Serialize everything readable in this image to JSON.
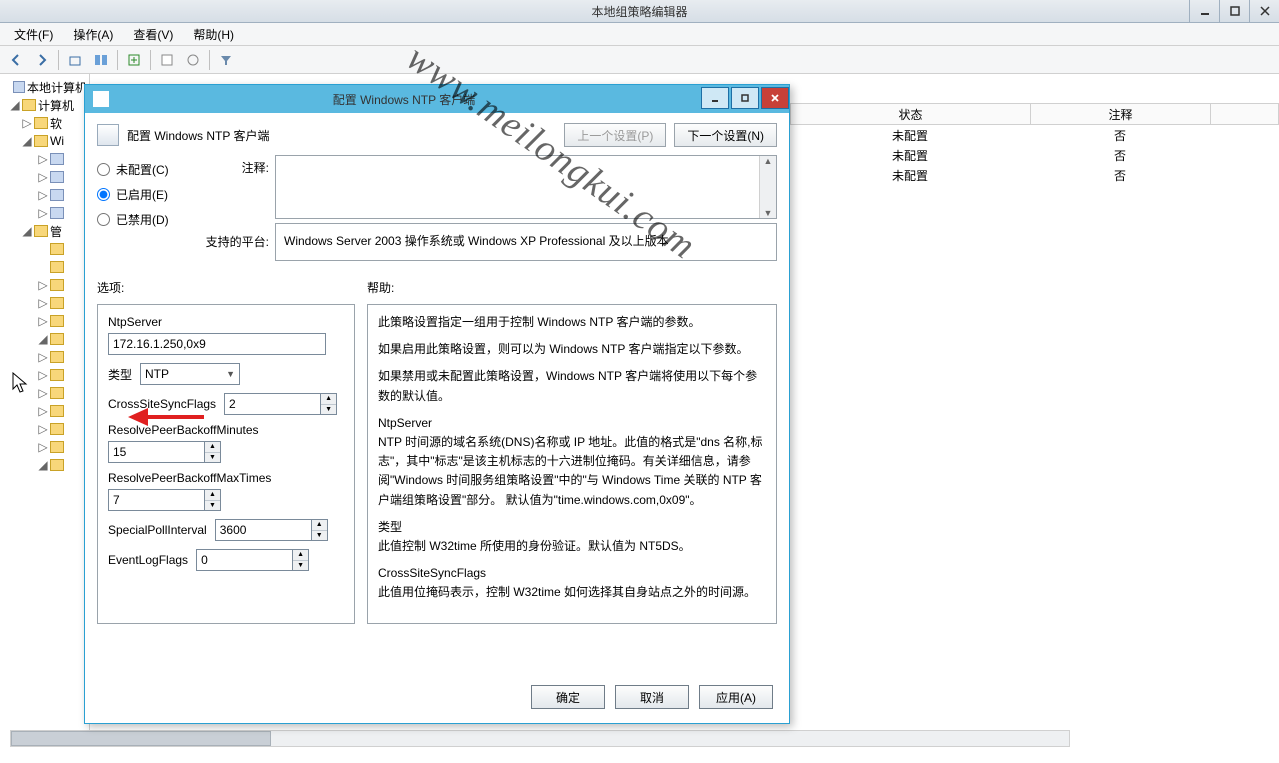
{
  "main": {
    "title": "本地组策略编辑器",
    "menus": {
      "file": "文件(F)",
      "action": "操作(A)",
      "view": "查看(V)",
      "help": "帮助(H)"
    }
  },
  "tree": {
    "root": "本地计算机",
    "n1": "计算机",
    "n2": "软",
    "n3": "Wi",
    "n_admin": "管"
  },
  "list": {
    "hdr_status": "状态",
    "hdr_comment": "注释",
    "rows": [
      {
        "status": "未配置",
        "comment": "否"
      },
      {
        "status": "未配置",
        "comment": "否"
      },
      {
        "status": "未配置",
        "comment": "否"
      }
    ]
  },
  "dialog": {
    "title": "配置 Windows NTP 客户端",
    "header_title": "配置 Windows NTP 客户端",
    "prev": "上一个设置(P)",
    "next": "下一个设置(N)",
    "radio_notconf": "未配置(C)",
    "radio_enabled": "已启用(E)",
    "radio_disabled": "已禁用(D)",
    "comment_label": "注释:",
    "platform_label": "支持的平台:",
    "platform_text": "Windows Server 2003 操作系统或 Windows XP Professional 及以上版本",
    "options_label": "选项:",
    "help_label": "帮助:",
    "opts": {
      "ntpserver_label": "NtpServer",
      "ntpserver_value": "172.16.1.250,0x9",
      "type_label": "类型",
      "type_value": "NTP",
      "crosssite_label": "CrossSiteSyncFlags",
      "crosssite_value": "2",
      "resolvemin_label": "ResolvePeerBackoffMinutes",
      "resolvemin_value": "15",
      "resolvemax_label": "ResolvePeerBackoffMaxTimes",
      "resolvemax_value": "7",
      "special_label": "SpecialPollInterval",
      "special_value": "3600",
      "eventlog_label": "EventLogFlags",
      "eventlog_value": "0"
    },
    "help": {
      "p1": "此策略设置指定一组用于控制 Windows NTP 客户端的参数。",
      "p2": "如果启用此策略设置，则可以为 Windows NTP 客户端指定以下参数。",
      "p3": "如果禁用或未配置此策略设置，Windows NTP 客户端将使用以下每个参数的默认值。",
      "h1": "NtpServer",
      "p4": "NTP 时间源的域名系统(DNS)名称或 IP 地址。此值的格式是\"dns 名称,标志\"，其中\"标志\"是该主机标志的十六进制位掩码。有关详细信息，请参阅\"Windows 时间服务组策略设置\"中的\"与 Windows Time 关联的 NTP 客户端组策略设置\"部分。  默认值为\"time.windows.com,0x09\"。",
      "h2": "类型",
      "p5": "此值控制 W32time 所使用的身份验证。默认值为 NT5DS。",
      "h3": "CrossSiteSyncFlags",
      "p6": "此值用位掩码表示，控制 W32time 如何选择其自身站点之外的时间源。"
    },
    "ok": "确定",
    "cancel": "取消",
    "apply": "应用(A)"
  },
  "watermark": "www.meilongkui.com"
}
